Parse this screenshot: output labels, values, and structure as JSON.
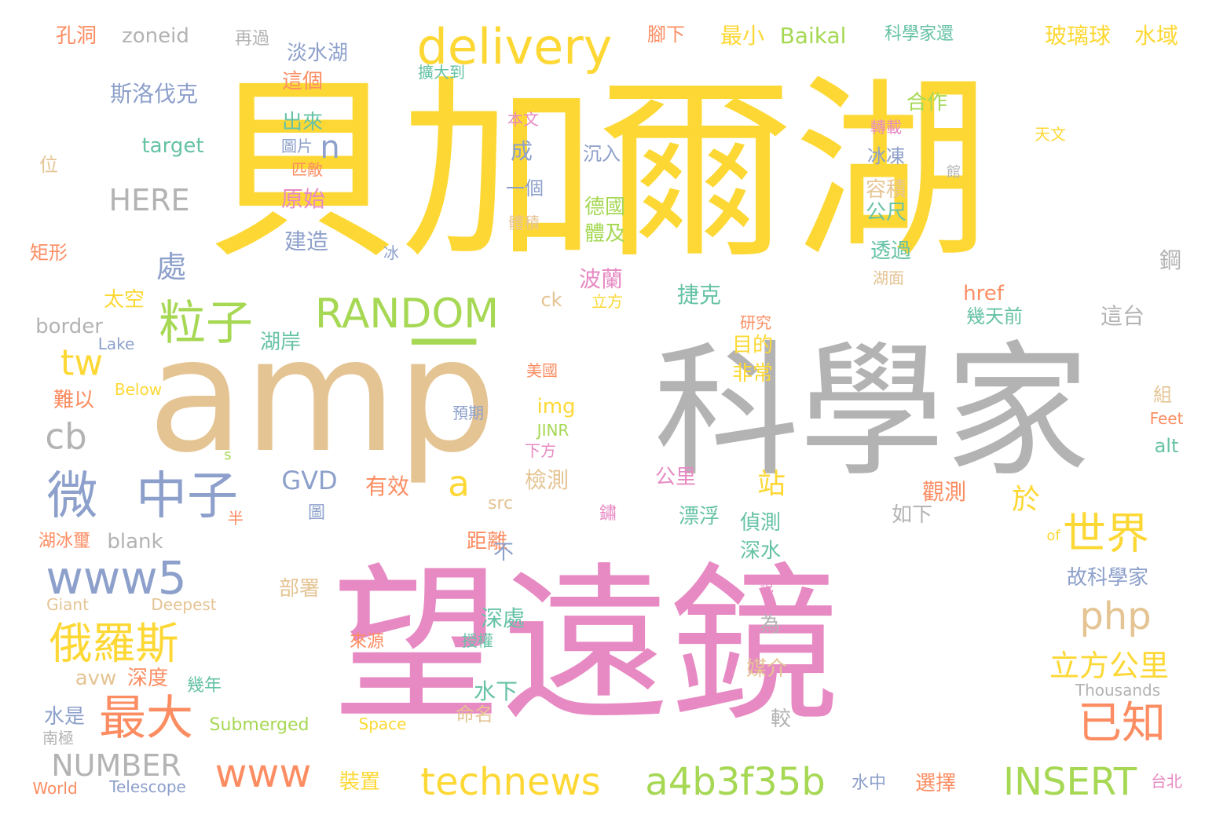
{
  "palette": {
    "yellow": "#fdd835",
    "pink": "#e78ac3",
    "gray": "#b3b3b3",
    "tan": "#e5c494",
    "green": "#a6d854",
    "blue": "#8da0cb",
    "orange": "#fc8d62",
    "teal": "#66c2a5"
  },
  "words": [
    {
      "text": "貝加爾湖",
      "color": "yellow"
    },
    {
      "text": "望遠鏡",
      "color": "pink"
    },
    {
      "text": "科學家",
      "color": "gray"
    },
    {
      "text": "amp",
      "color": "tan"
    },
    {
      "text": "一",
      "color": "green"
    },
    {
      "text": "delivery",
      "color": "yellow"
    },
    {
      "text": "RANDOM",
      "color": "green"
    },
    {
      "text": "粒子",
      "color": "green"
    },
    {
      "text": "微",
      "color": "blue"
    },
    {
      "text": "中子",
      "color": "blue"
    },
    {
      "text": "www5",
      "color": "blue"
    },
    {
      "text": "俄羅斯",
      "color": "yellow"
    },
    {
      "text": "最大",
      "color": "orange"
    },
    {
      "text": "www",
      "color": "orange"
    },
    {
      "text": "technews",
      "color": "yellow"
    },
    {
      "text": "a4b3f35b",
      "color": "green"
    },
    {
      "text": "INSERT",
      "color": "green"
    },
    {
      "text": "世界",
      "color": "yellow"
    },
    {
      "text": "已知",
      "color": "orange"
    },
    {
      "text": "php",
      "color": "tan"
    },
    {
      "text": "立方公里",
      "color": "yellow"
    },
    {
      "text": "NUMBER",
      "color": "gray"
    },
    {
      "text": "HERE",
      "color": "gray"
    },
    {
      "text": "cb",
      "color": "gray"
    },
    {
      "text": "tw",
      "color": "yellow"
    },
    {
      "text": "n",
      "color": "blue"
    },
    {
      "text": "a",
      "color": "yellow"
    },
    {
      "text": "GVD",
      "color": "blue"
    },
    {
      "text": "處",
      "color": "blue"
    },
    {
      "text": "斯洛伐克",
      "color": "blue"
    },
    {
      "text": "target",
      "color": "teal"
    },
    {
      "text": "玻璃球",
      "color": "yellow"
    },
    {
      "text": "水域",
      "color": "yellow"
    },
    {
      "text": "最小",
      "color": "yellow"
    },
    {
      "text": "Baikal",
      "color": "green"
    },
    {
      "text": "zoneid",
      "color": "gray"
    },
    {
      "text": "孔洞",
      "color": "orange"
    },
    {
      "text": "再過",
      "color": "gray"
    },
    {
      "text": "淡水湖",
      "color": "blue"
    },
    {
      "text": "腳下",
      "color": "orange"
    },
    {
      "text": "科學家還",
      "color": "teal"
    },
    {
      "text": "擴大到",
      "color": "teal"
    },
    {
      "text": "這個",
      "color": "orange"
    },
    {
      "text": "出來",
      "color": "teal"
    },
    {
      "text": "圖片",
      "color": "blue"
    },
    {
      "text": "匹敵",
      "color": "orange"
    },
    {
      "text": "原始",
      "color": "pink"
    },
    {
      "text": "建造",
      "color": "blue"
    },
    {
      "text": "成",
      "color": "blue"
    },
    {
      "text": "一個",
      "color": "blue"
    },
    {
      "text": "體積",
      "color": "tan"
    },
    {
      "text": "本文",
      "color": "pink"
    },
    {
      "text": "沉入",
      "color": "blue"
    },
    {
      "text": "德國",
      "color": "green"
    },
    {
      "text": "體及",
      "color": "green"
    },
    {
      "text": "波蘭",
      "color": "pink"
    },
    {
      "text": "立方",
      "color": "yellow"
    },
    {
      "text": "合作",
      "color": "green"
    },
    {
      "text": "轉載",
      "color": "pink"
    },
    {
      "text": "天文",
      "color": "yellow"
    },
    {
      "text": "冰凍",
      "color": "blue"
    },
    {
      "text": "容積",
      "color": "tan"
    },
    {
      "text": "公尺",
      "color": "teal"
    },
    {
      "text": "透過",
      "color": "teal"
    },
    {
      "text": "湖面",
      "color": "tan"
    },
    {
      "text": "捷克",
      "color": "teal"
    },
    {
      "text": "href",
      "color": "orange"
    },
    {
      "text": "幾天前",
      "color": "teal"
    },
    {
      "text": "這台",
      "color": "gray"
    },
    {
      "text": "鋼",
      "color": "gray"
    },
    {
      "text": "館",
      "color": "gray"
    },
    {
      "text": "位",
      "color": "tan"
    },
    {
      "text": "矩形",
      "color": "orange"
    },
    {
      "text": "太空",
      "color": "yellow"
    },
    {
      "text": "border",
      "color": "gray"
    },
    {
      "text": "湖岸",
      "color": "teal"
    },
    {
      "text": "Lake",
      "color": "blue"
    },
    {
      "text": "ck",
      "color": "tan"
    },
    {
      "text": "冰",
      "color": "blue"
    },
    {
      "text": "研究",
      "color": "orange"
    },
    {
      "text": "目的",
      "color": "yellow"
    },
    {
      "text": "非常",
      "color": "yellow"
    },
    {
      "text": "美國",
      "color": "orange"
    },
    {
      "text": "Below",
      "color": "yellow"
    },
    {
      "text": "難以",
      "color": "orange"
    },
    {
      "text": "img",
      "color": "yellow"
    },
    {
      "text": "預期",
      "color": "blue"
    },
    {
      "text": "JINR",
      "color": "green"
    },
    {
      "text": "下方",
      "color": "pink"
    },
    {
      "text": "組",
      "color": "tan"
    },
    {
      "text": "Feet",
      "color": "orange"
    },
    {
      "text": "alt",
      "color": "teal"
    },
    {
      "text": "s",
      "color": "green"
    },
    {
      "text": "檢測",
      "color": "tan"
    },
    {
      "text": "公里",
      "color": "pink"
    },
    {
      "text": "有效",
      "color": "orange"
    },
    {
      "text": "站",
      "color": "yellow"
    },
    {
      "text": "於",
      "color": "yellow"
    },
    {
      "text": "觀測",
      "color": "orange"
    },
    {
      "text": "src",
      "color": "tan"
    },
    {
      "text": "如下",
      "color": "gray"
    },
    {
      "text": "圖",
      "color": "blue"
    },
    {
      "text": "半",
      "color": "orange"
    },
    {
      "text": "鏽",
      "color": "pink"
    },
    {
      "text": "漂浮",
      "color": "teal"
    },
    {
      "text": "偵測",
      "color": "teal"
    },
    {
      "text": "距離",
      "color": "orange"
    },
    {
      "text": "湖冰璽",
      "color": "orange"
    },
    {
      "text": "blank",
      "color": "gray"
    },
    {
      "text": "不",
      "color": "blue"
    },
    {
      "text": "深水",
      "color": "teal"
    },
    {
      "text": "of",
      "color": "yellow"
    },
    {
      "text": "故科學家",
      "color": "blue"
    },
    {
      "text": "部署",
      "color": "tan"
    },
    {
      "text": "說",
      "color": "pink"
    },
    {
      "text": "Giant",
      "color": "tan"
    },
    {
      "text": "Deepest",
      "color": "tan"
    },
    {
      "text": "深處",
      "color": "teal"
    },
    {
      "text": "為",
      "color": "gray"
    },
    {
      "text": "avw",
      "color": "tan"
    },
    {
      "text": "深度",
      "color": "orange"
    },
    {
      "text": "幾年",
      "color": "teal"
    },
    {
      "text": "媒介",
      "color": "tan"
    },
    {
      "text": "來源",
      "color": "orange"
    },
    {
      "text": "授權",
      "color": "teal"
    },
    {
      "text": "水下",
      "color": "teal"
    },
    {
      "text": "Thousands",
      "color": "gray"
    },
    {
      "text": "水是",
      "color": "blue"
    },
    {
      "text": "命名",
      "color": "tan"
    },
    {
      "text": "較",
      "color": "gray"
    },
    {
      "text": "南極",
      "color": "gray"
    },
    {
      "text": "Submerged",
      "color": "green"
    },
    {
      "text": "Space",
      "color": "yellow"
    },
    {
      "text": "World",
      "color": "orange"
    },
    {
      "text": "Telescope",
      "color": "blue"
    },
    {
      "text": "裝置",
      "color": "yellow"
    },
    {
      "text": "水中",
      "color": "blue"
    },
    {
      "text": "選擇",
      "color": "orange"
    },
    {
      "text": "台北",
      "color": "pink"
    }
  ]
}
